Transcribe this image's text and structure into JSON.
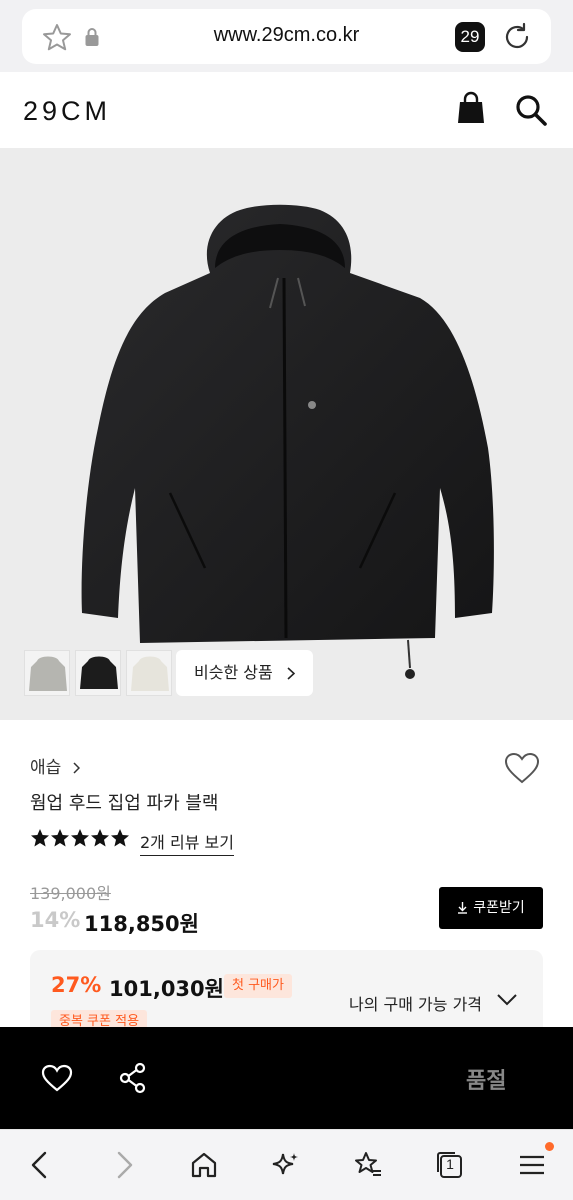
{
  "browser": {
    "url": "www.29cm.co.kr",
    "tab_count": "29",
    "nav": {
      "back": "back-icon",
      "forward": "forward-icon",
      "home": "home-icon",
      "ai": "sparkle-icon",
      "bookmarks": "star-list-icon",
      "tabs_count": "1",
      "menu": "menu-icon"
    }
  },
  "header": {
    "logo": "29CM",
    "cart_icon": "shopping-bag-icon",
    "search_icon": "search-icon"
  },
  "gallery": {
    "similar_label": "비슷한 상품"
  },
  "product": {
    "brand": "애습",
    "name": "웜업 후드 집업 파카 블랙",
    "rating_stars": 5,
    "review_link": "2개 리뷰 보기",
    "original_price": "139,000원",
    "discount_rate": "14%",
    "sale_price": "118,850원",
    "coupon_button": "쿠폰받기",
    "best_price": {
      "rate": "27%",
      "price": "101,030원",
      "badge": "첫 구매가",
      "badge2": "중복 쿠폰 적용",
      "toggle_label": "나의 구매 가능 가격"
    }
  },
  "buybar": {
    "status": "품절"
  },
  "colors": {
    "accent": "#ff5a1f",
    "dark": "#000000",
    "muted": "#888888"
  }
}
